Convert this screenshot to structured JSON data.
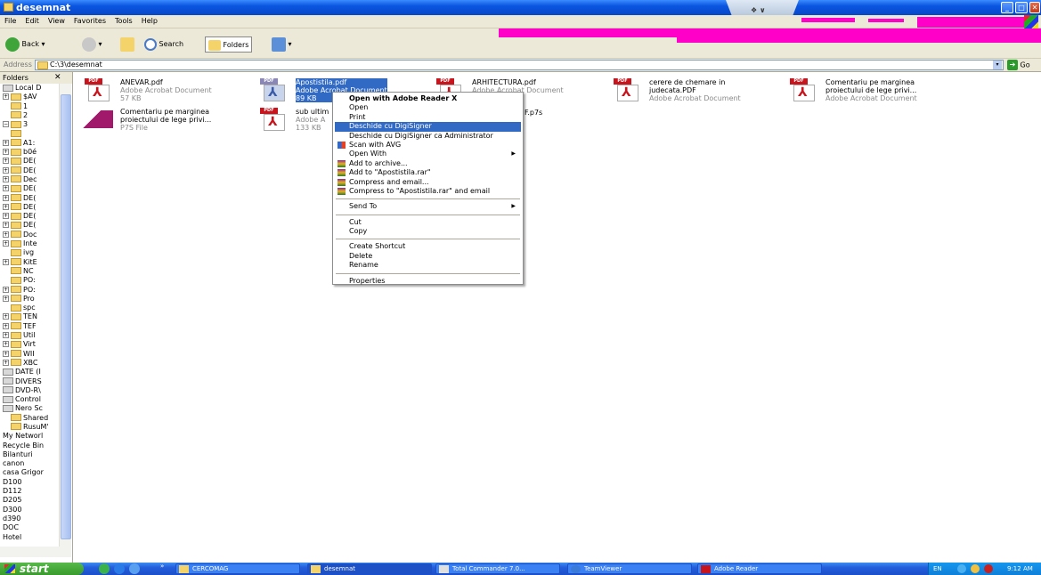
{
  "window": {
    "title": "desemnat",
    "title_strip": "❖ ∨"
  },
  "menu": [
    "File",
    "Edit",
    "View",
    "Favorites",
    "Tools",
    "Help"
  ],
  "toolbar": {
    "back_label": "Back",
    "search_label": "Search",
    "folders_label": "Folders"
  },
  "address": {
    "label": "Address",
    "value": "C:\\3\\desemnat",
    "go_label": "Go"
  },
  "folders_pane": {
    "title": "Folders",
    "tree": [
      {
        "label": "Local D",
        "kind": "drive",
        "expander": ""
      },
      {
        "label": "$AV",
        "kind": "folder",
        "expander": "+"
      },
      {
        "label": "1",
        "kind": "folder",
        "expander": ""
      },
      {
        "label": "2",
        "kind": "folder",
        "expander": ""
      },
      {
        "label": "3",
        "kind": "folder",
        "expander": "−"
      },
      {
        "label": "",
        "kind": "folder",
        "expander": ""
      },
      {
        "label": "A1:",
        "kind": "folder",
        "expander": "+"
      },
      {
        "label": "b0é",
        "kind": "folder",
        "expander": "+"
      },
      {
        "label": "DE(",
        "kind": "folder",
        "expander": "+"
      },
      {
        "label": "DE(",
        "kind": "folder",
        "expander": "+"
      },
      {
        "label": "Dec",
        "kind": "folder",
        "expander": "+"
      },
      {
        "label": "DE(",
        "kind": "folder",
        "expander": "+"
      },
      {
        "label": "DE(",
        "kind": "folder",
        "expander": "+"
      },
      {
        "label": "DE(",
        "kind": "folder",
        "expander": "+"
      },
      {
        "label": "DE(",
        "kind": "folder",
        "expander": "+"
      },
      {
        "label": "DE(",
        "kind": "folder",
        "expander": "+"
      },
      {
        "label": "Doc",
        "kind": "folder",
        "expander": "+"
      },
      {
        "label": "Inte",
        "kind": "folder",
        "expander": "+"
      },
      {
        "label": "ivg",
        "kind": "folder",
        "expander": ""
      },
      {
        "label": "KitE",
        "kind": "folder",
        "expander": "+"
      },
      {
        "label": "NC",
        "kind": "folder",
        "expander": ""
      },
      {
        "label": "PO:",
        "kind": "folder",
        "expander": ""
      },
      {
        "label": "PO:",
        "kind": "folder",
        "expander": "+"
      },
      {
        "label": "Pro",
        "kind": "folder",
        "expander": "+"
      },
      {
        "label": "spc",
        "kind": "folder",
        "expander": ""
      },
      {
        "label": "TEN",
        "kind": "folder",
        "expander": "+"
      },
      {
        "label": "TEF",
        "kind": "folder",
        "expander": "+"
      },
      {
        "label": "Util",
        "kind": "folder",
        "expander": "+"
      },
      {
        "label": "Virt",
        "kind": "folder",
        "expander": "+"
      },
      {
        "label": "WII",
        "kind": "folder",
        "expander": "+"
      },
      {
        "label": "XBC",
        "kind": "folder",
        "expander": "+"
      },
      {
        "label": "DATE (I",
        "kind": "drive",
        "expander": ""
      },
      {
        "label": "DIVERS",
        "kind": "drive",
        "expander": ""
      },
      {
        "label": "DVD-R\\",
        "kind": "drive",
        "expander": ""
      },
      {
        "label": "Control",
        "kind": "drive",
        "expander": ""
      },
      {
        "label": "Nero Sc",
        "kind": "drive",
        "expander": ""
      },
      {
        "label": "Shared",
        "kind": "folder",
        "expander": ""
      },
      {
        "label": "RusuM'",
        "kind": "folder",
        "expander": ""
      },
      {
        "label": "My Networl",
        "kind": "plain",
        "expander": ""
      },
      {
        "label": "Recycle Bin",
        "kind": "plain",
        "expander": ""
      },
      {
        "label": "Bilanturi",
        "kind": "plain",
        "expander": ""
      },
      {
        "label": "canon",
        "kind": "plain",
        "expander": ""
      },
      {
        "label": "casa Grigor",
        "kind": "plain",
        "expander": ""
      },
      {
        "label": "D100",
        "kind": "plain",
        "expander": ""
      },
      {
        "label": "D112",
        "kind": "plain",
        "expander": ""
      },
      {
        "label": "D205",
        "kind": "plain",
        "expander": ""
      },
      {
        "label": "D300",
        "kind": "plain",
        "expander": ""
      },
      {
        "label": "d390",
        "kind": "plain",
        "expander": ""
      },
      {
        "label": "DOC",
        "kind": "plain",
        "expander": ""
      },
      {
        "label": "Hotel",
        "kind": "plain",
        "expander": ""
      }
    ]
  },
  "files": [
    {
      "name": "ANEVAR.pdf",
      "type": "Adobe Acrobat Document",
      "size": "57 KB",
      "icon": "pdf-icon",
      "selected": false
    },
    {
      "name": "Apostistila.pdf",
      "type": "Adobe Acrobat Document",
      "size": "89 KB",
      "icon": "pdf-icon",
      "selected": true
    },
    {
      "name": "ARHITECTURA.pdf",
      "type": "Adobe Acrobat Document",
      "size": "",
      "icon": "pdf-icon",
      "selected": false
    },
    {
      "name": "cerere de chemare in",
      "name2": "judecata.PDF",
      "type": "Adobe Acrobat Document",
      "icon": "pdf-icon",
      "selected": false
    },
    {
      "name": "Comentariu pe marginea",
      "name2": "proiectului de lege privi...",
      "type": "Adobe Acrobat Document",
      "icon": "pdf-icon",
      "selected": false
    },
    {
      "name": "Comentariu pe marginea",
      "name2": "proiectului de lege privi...",
      "type": "P7S File",
      "icon": "p7s-icon",
      "selected": false
    },
    {
      "name": "sub ultim",
      "type": "Adobe A",
      "size": "133 KB",
      "icon": "pdf-icon",
      "selected": false
    },
    {
      "name": "F.p7s",
      "icon": "none",
      "selected": false
    }
  ],
  "context_menu": [
    {
      "label": "Open with Adobe Reader X",
      "bold": true
    },
    {
      "label": "Open"
    },
    {
      "label": "Print"
    },
    {
      "label": "Deschide cu DigiSigner",
      "highlighted": true
    },
    {
      "label": "Deschide cu DigiSigner ca Administrator"
    },
    {
      "label": "Scan with AVG",
      "icon": "avg-icon"
    },
    {
      "label": "Open With",
      "submenu": true
    },
    {
      "label": "Add to archive...",
      "icon": "winrar-icon"
    },
    {
      "label": "Add to \"Apostistila.rar\"",
      "icon": "winrar-icon"
    },
    {
      "label": "Compress and email...",
      "icon": "winrar-icon"
    },
    {
      "label": "Compress to \"Apostistila.rar\" and email",
      "icon": "winrar-icon"
    },
    {
      "separator": true
    },
    {
      "label": "Send To",
      "submenu": true
    },
    {
      "separator": true
    },
    {
      "label": "Cut"
    },
    {
      "label": "Copy"
    },
    {
      "separator": true
    },
    {
      "label": "Create Shortcut"
    },
    {
      "label": "Delete"
    },
    {
      "label": "Rename"
    },
    {
      "separator": true
    },
    {
      "label": "Properties"
    }
  ],
  "taskbar": {
    "start_label": "start",
    "tasks": [
      {
        "label": "CERCOMAG",
        "active": false
      },
      {
        "label": "desemnat",
        "active": true
      },
      {
        "label": "Total Commander 7.0...",
        "active": false
      },
      {
        "label": "TeamViewer",
        "active": false
      },
      {
        "label": "Adobe Reader",
        "active": false
      }
    ],
    "language": "EN",
    "clock": "9:12 AM"
  },
  "colors": {
    "selection": "#316ac5",
    "titlebar": "#0a55e0",
    "pdf_red": "#c8151d",
    "start_green": "#3a9a2e",
    "artifact_magenta": "#ff00c8"
  }
}
